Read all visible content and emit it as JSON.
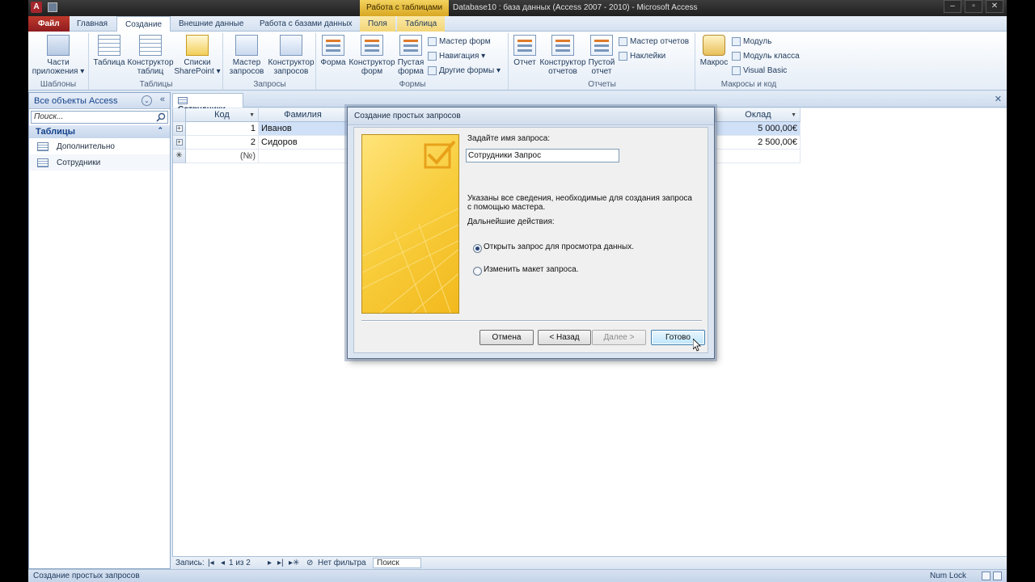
{
  "window": {
    "title": "Database10 : база данных (Access 2007 - 2010)  -  Microsoft Access",
    "context_tab": "Работа с таблицами",
    "app_icon": "A"
  },
  "ribbon_tabs": [
    "Файл",
    "Главная",
    "Создание",
    "Внешние данные",
    "Работа с базами данных",
    "Поля",
    "Таблица"
  ],
  "ribbon": {
    "templates": {
      "label": "Шаблоны",
      "parts": "Части приложения ▾"
    },
    "tables": {
      "label": "Таблицы",
      "table": "Таблица",
      "table_designer": "Конструктор таблиц",
      "sharepoint": "Списки SharePoint ▾"
    },
    "queries": {
      "label": "Запросы",
      "wizard": "Мастер запросов",
      "designer": "Конструктор запросов"
    },
    "forms": {
      "label": "Формы",
      "form": "Форма",
      "designer": "Конструктор форм",
      "blank": "Пустая форма",
      "wizard": "Мастер форм",
      "navigation": "Навигация ▾",
      "other": "Другие формы ▾"
    },
    "reports": {
      "label": "Отчеты",
      "report": "Отчет",
      "designer": "Конструктор отчетов",
      "blank": "Пустой отчет",
      "wizard": "Мастер отчетов",
      "labels": "Наклейки"
    },
    "macros": {
      "label": "Макросы и код",
      "macro": "Макрос",
      "module": "Модуль",
      "class_module": "Модуль класса",
      "vb": "Visual Basic"
    }
  },
  "nav_pane": {
    "header": "Все объекты Access",
    "search_placeholder": "Поиск...",
    "section": "Таблицы",
    "items": [
      "Дополнительно",
      "Сотрудники"
    ]
  },
  "document": {
    "tab": "Сотрудники",
    "columns": {
      "code": "Код",
      "surname": "Фамилия",
      "salary": "Оклад"
    },
    "rows": [
      {
        "code": "1",
        "surname": "Иванов",
        "salary": "5 000,00€"
      },
      {
        "code": "2",
        "surname": "Сидоров",
        "salary": "2 500,00€"
      }
    ],
    "new_row": "(№)"
  },
  "record_bar": {
    "label": "Запись:",
    "position": "1 из 2",
    "filter": "Нет фильтра",
    "search": "Поиск"
  },
  "dialog": {
    "title": "Создание простых запросов",
    "name_prompt": "Задайте имя запроса:",
    "name_value": "Сотрудники Запрос",
    "info": "Указаны все сведения, необходимые для создания запроса с помощью мастера.",
    "next_actions": "Дальнейшие действия:",
    "option_open": "Открыть запрос для просмотра данных.",
    "option_modify": "Изменить макет запроса.",
    "buttons": {
      "cancel": "Отмена",
      "back": "< Назад",
      "next": "Далее >",
      "finish": "Готово"
    }
  },
  "status": {
    "left": "Создание простых запросов",
    "numlock": "Num Lock"
  }
}
